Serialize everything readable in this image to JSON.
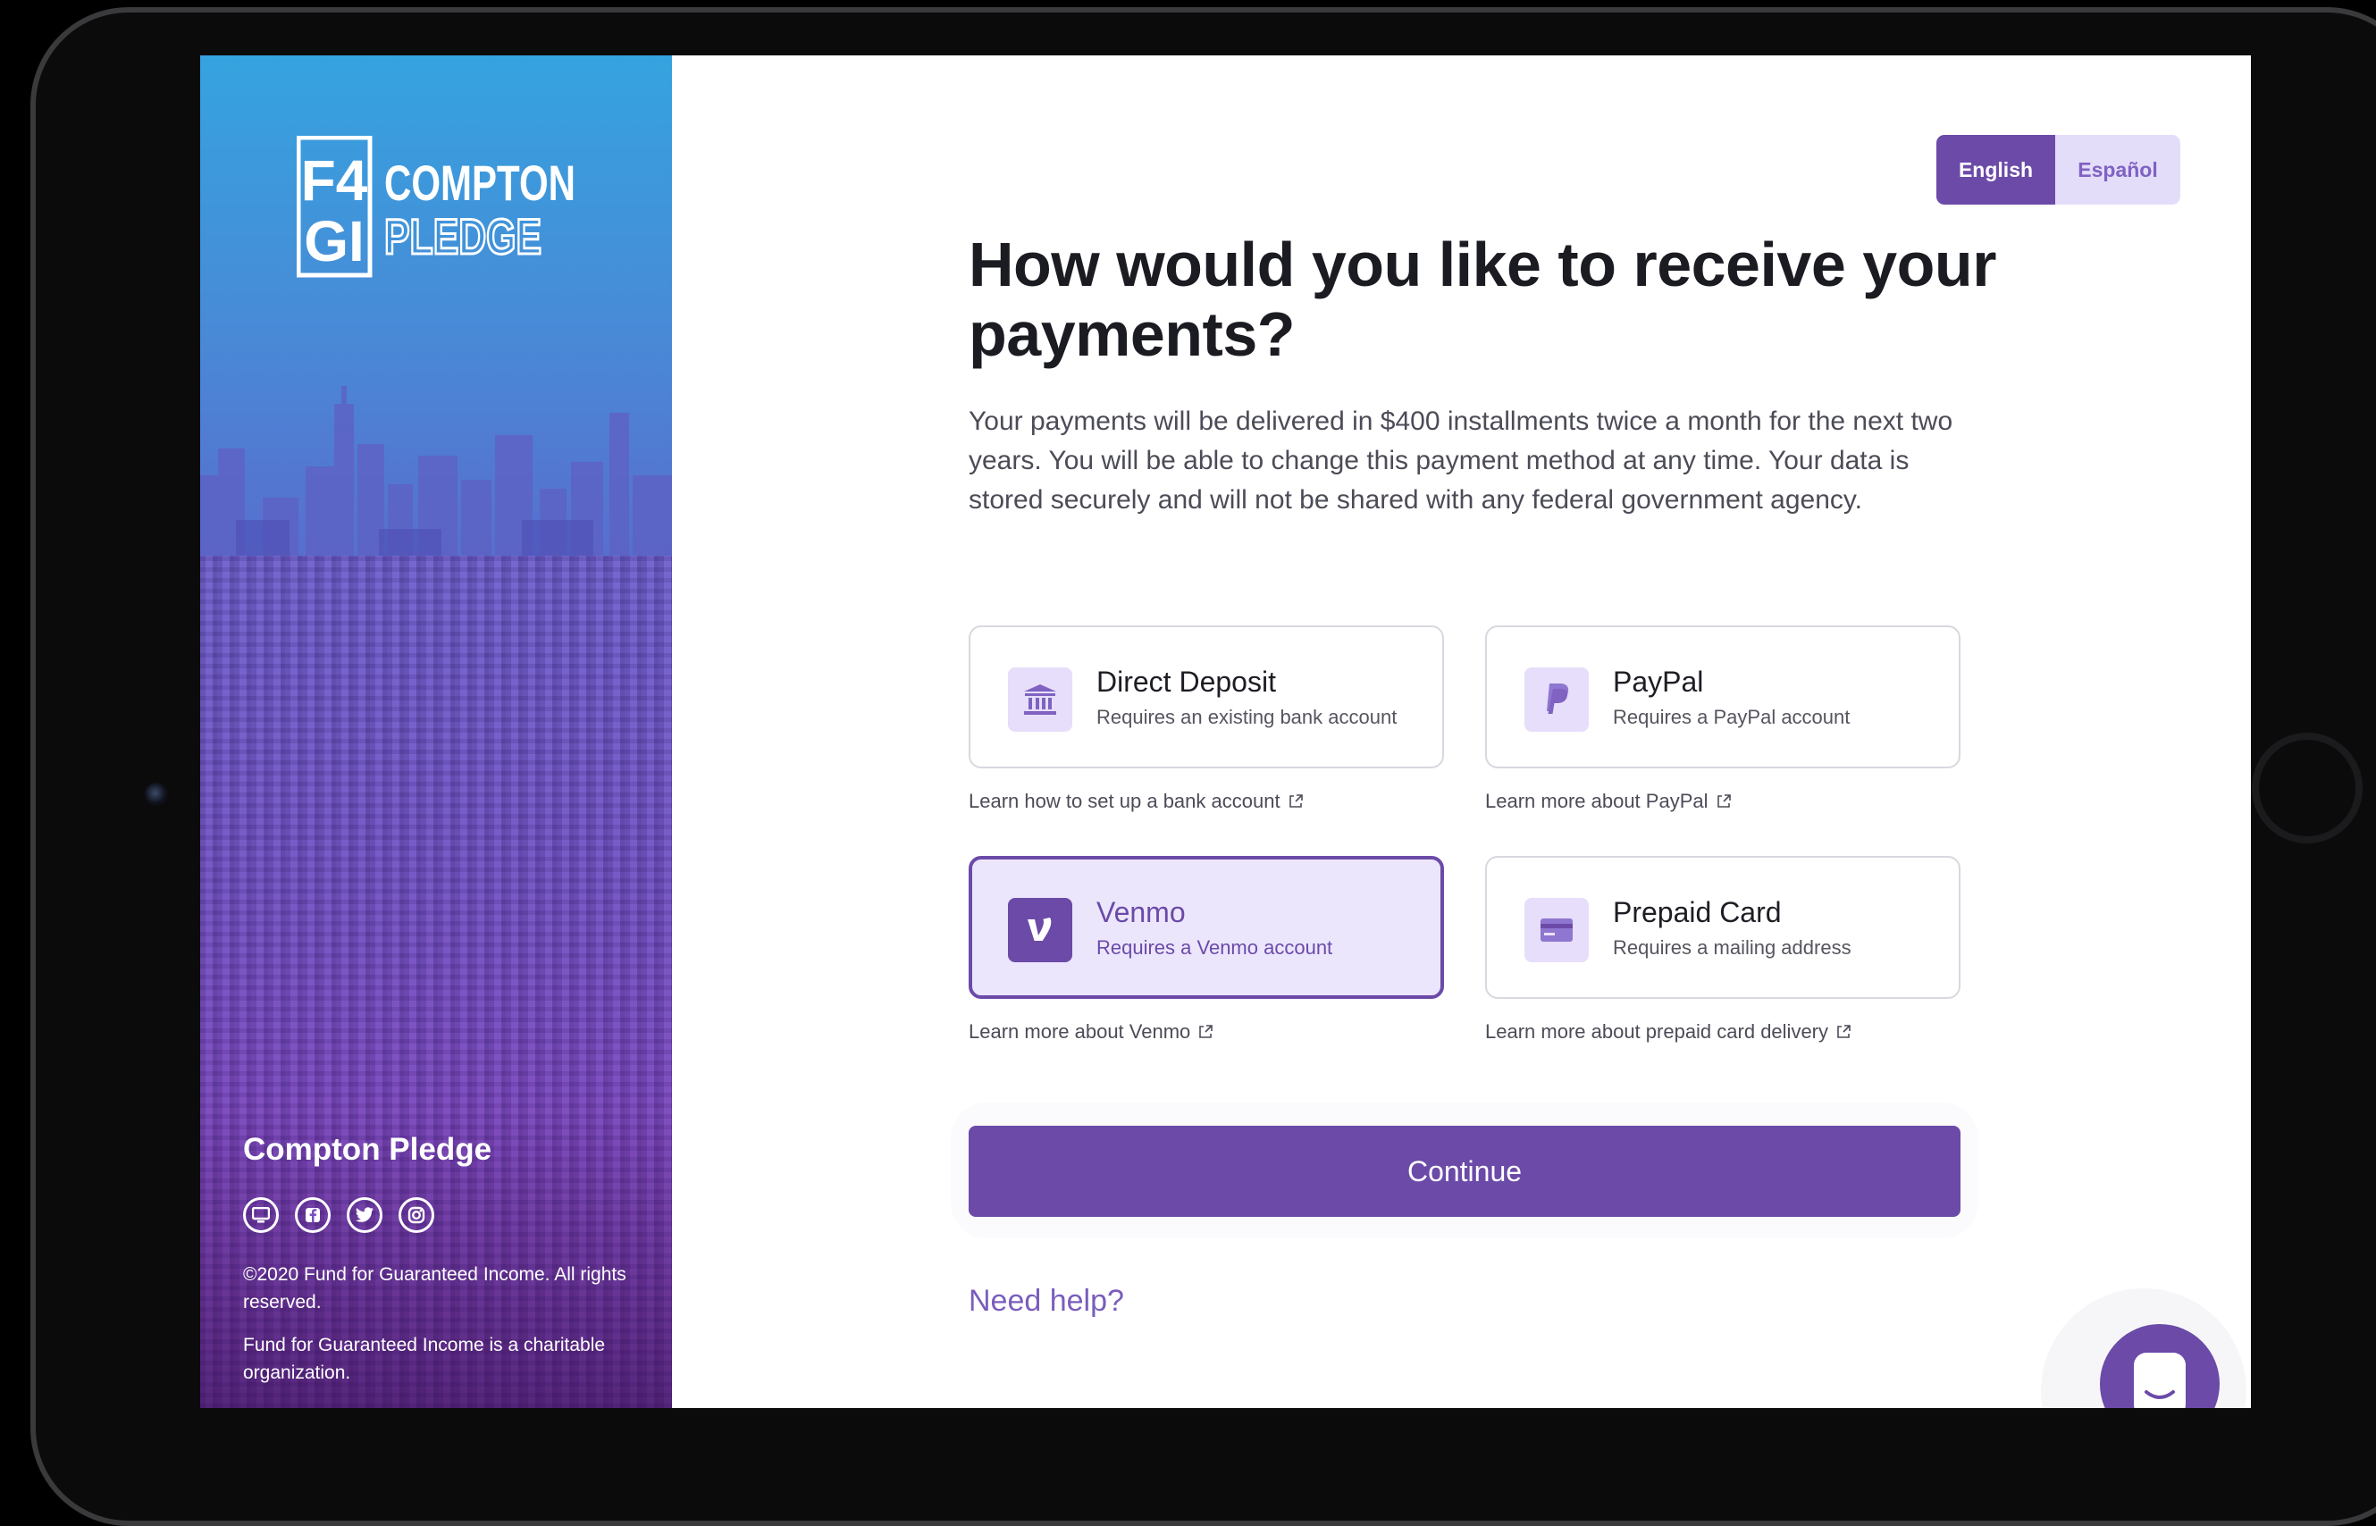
{
  "sidebar": {
    "logo_letters": "F4GI",
    "logo_words": [
      "COMPTON",
      "PLEDGE"
    ],
    "org_name": "Compton Pledge",
    "social_icons": [
      "website-icon",
      "facebook-icon",
      "twitter-icon",
      "instagram-icon"
    ],
    "copyright": "©2020 Fund for Guaranteed Income. All rights reserved.",
    "charity_note": "Fund for Guaranteed Income is a charitable organization."
  },
  "language": {
    "english": "English",
    "espanol": "Español",
    "selected": "English"
  },
  "main": {
    "title": "How would you like to receive your payments?",
    "description": "Your payments will be delivered in $400 installments twice a month for the next two years. You will be able to change this payment method at any time. Your data is stored securely and will not be shared with any federal government agency.",
    "options": [
      {
        "title": "Direct Deposit",
        "subtitle": "Requires an existing bank account",
        "learn": "Learn how to set up a bank account",
        "icon": "bank-icon",
        "selected": false
      },
      {
        "title": "PayPal",
        "subtitle": "Requires a PayPal account",
        "learn": "Learn more about PayPal",
        "icon": "paypal-icon",
        "selected": false
      },
      {
        "title": "Venmo",
        "subtitle": "Requires a Venmo account",
        "learn": "Learn more about Venmo",
        "icon": "venmo-icon",
        "selected": true
      },
      {
        "title": "Prepaid Card",
        "subtitle": "Requires a mailing address",
        "learn": "Learn more about prepaid card delivery",
        "icon": "card-icon",
        "selected": false
      }
    ],
    "continue_label": "Continue",
    "help_label": "Need help?"
  },
  "colors": {
    "accent": "#6b4aa8",
    "accent_light": "#e6defa",
    "selected_bg": "#ece6fd",
    "text_dark": "#1b1b22",
    "text_muted": "#4c4c58"
  }
}
